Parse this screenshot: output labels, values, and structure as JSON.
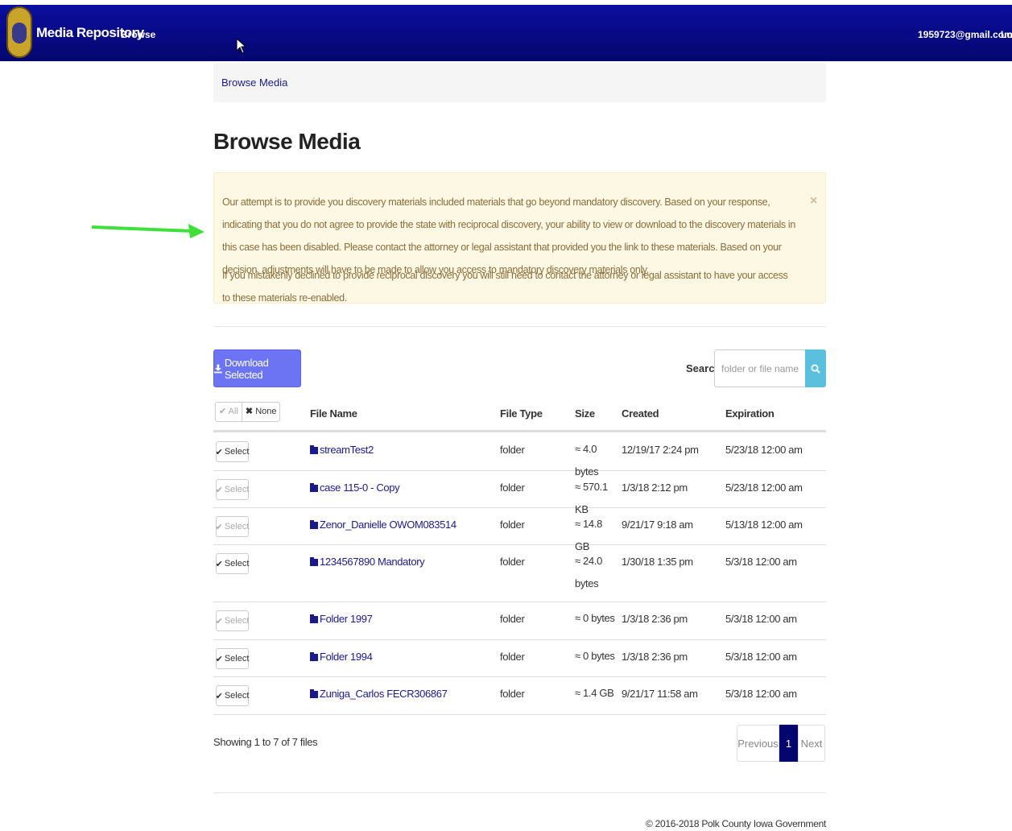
{
  "nav": {
    "brand": "Media Repository",
    "browse": "Browse",
    "email": "1959723@gmail.com",
    "logout": "Lo"
  },
  "breadcrumb": "Browse Media",
  "title": "Browse Media",
  "alert": {
    "p1": "Our attempt is to provide you discovery materials included materials that go beyond mandatory discovery. Based on your response, indicating that you do not agree to provide the state with reciprocal discovery, your ability to view or download to the discovery materials in this case has been disabled. Please contact the attorney or legal assistant that provided you the link to these materials. Based on your decision, adjustments will have to be made to allow you access to mandatory discovery materials only.",
    "p2": "If you mistakenly declined to provide reciprocal discovery you will still need to contact the attorney or legal assistant to have your access to these materials re-enabled.",
    "close": "×"
  },
  "toolbar": {
    "download_label": "Download Selected",
    "search_label": "Search",
    "search_placeholder": "folder or file name"
  },
  "table": {
    "all_label": "All",
    "none_label": "None",
    "headers": {
      "name": "File Name",
      "type": "File Type",
      "size": "Size",
      "created": "Created",
      "expiration": "Expiration"
    },
    "rows": [
      {
        "select": "Select",
        "enabled": true,
        "name": "streamTest2",
        "type": "folder",
        "size": "≈ 4.0 bytes",
        "created": "12/19/17 2:24 pm",
        "expiration": "5/23/18 12:00 am"
      },
      {
        "select": "Select",
        "enabled": false,
        "name": "case 115-0 - Copy",
        "type": "folder",
        "size": "≈ 570.1 KB",
        "created": "1/3/18 2:12 pm",
        "expiration": "5/23/18 12:00 am"
      },
      {
        "select": "Select",
        "enabled": false,
        "name": "Zenor_Danielle OWOM083514",
        "type": "folder",
        "size": "≈ 14.8 GB",
        "created": "9/21/17 9:18 am",
        "expiration": "5/13/18 12:00 am"
      },
      {
        "select": "Select",
        "enabled": true,
        "name": "1234567890 Mandatory",
        "type": "folder",
        "size": "≈ 24.0 bytes",
        "created": "1/30/18 1:35 pm",
        "expiration": "5/3/18 12:00 am"
      },
      {
        "select": "Select",
        "enabled": false,
        "name": "Folder 1997",
        "type": "folder",
        "size": "≈ 0 bytes",
        "created": "1/3/18 2:36 pm",
        "expiration": "5/3/18 12:00 am"
      },
      {
        "select": "Select",
        "enabled": true,
        "name": "Folder 1994",
        "type": "folder",
        "size": "≈ 0 bytes",
        "created": "1/3/18 2:36 pm",
        "expiration": "5/3/18 12:00 am"
      },
      {
        "select": "Select",
        "enabled": true,
        "name": "Zuniga_Carlos FECR306867",
        "type": "folder",
        "size": "≈ 1.4 GB",
        "created": "9/21/17 11:58 am",
        "expiration": "5/3/18 12:00 am"
      }
    ]
  },
  "showing": "Showing 1 to 7 of 7 files",
  "pager": {
    "prev": "Previous",
    "current": "1",
    "next": "Next"
  },
  "footer": "© 2016-2018 Polk County Iowa Government"
}
